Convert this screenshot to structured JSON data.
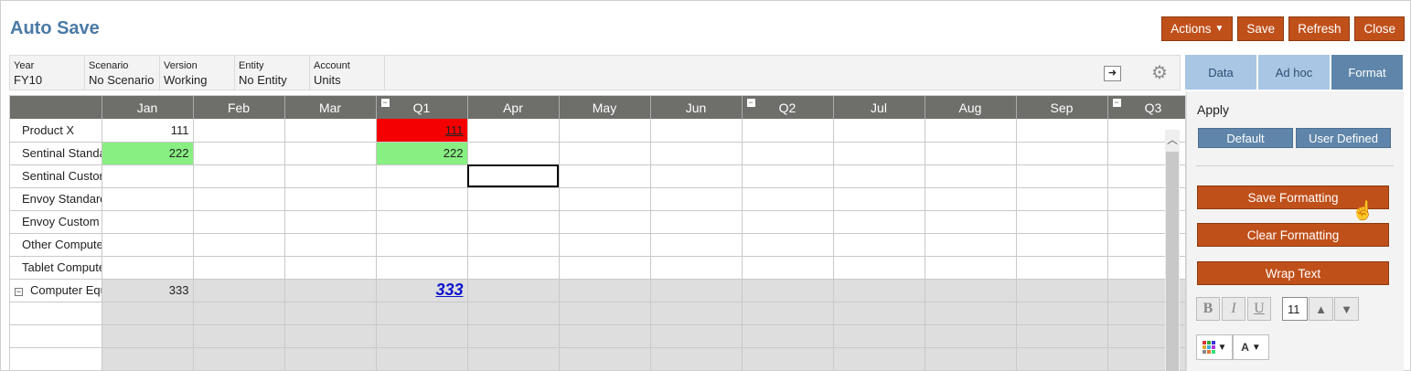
{
  "app": {
    "title": "Auto Save"
  },
  "toolbar": {
    "actions_label": "Actions",
    "save_label": "Save",
    "refresh_label": "Refresh",
    "close_label": "Close"
  },
  "pov": [
    {
      "label": "Year",
      "value": "FY10"
    },
    {
      "label": "Scenario",
      "value": "No Scenario"
    },
    {
      "label": "Version",
      "value": "Working"
    },
    {
      "label": "Entity",
      "value": "No Entity"
    },
    {
      "label": "Account",
      "value": "Units"
    }
  ],
  "panel_tabs": [
    "Data",
    "Ad hoc",
    "Format"
  ],
  "grid": {
    "columns": [
      "Jan",
      "Feb",
      "Mar",
      "Q1",
      "Apr",
      "May",
      "Jun",
      "Q2",
      "Jul",
      "Aug",
      "Sep",
      "Q3"
    ],
    "rows": [
      {
        "label": "Product X",
        "jan": "111",
        "q1": "111"
      },
      {
        "label": "Sentinal Standard",
        "jan": "222",
        "q1": "222"
      },
      {
        "label": "Sentinal Custom",
        "jan": "",
        "q1": ""
      },
      {
        "label": "Envoy Standard",
        "jan": "",
        "q1": ""
      },
      {
        "label": "Envoy Custom",
        "jan": "",
        "q1": ""
      },
      {
        "label": "Other Computers",
        "jan": "",
        "q1": ""
      },
      {
        "label": "Tablet Computers",
        "jan": "",
        "q1": ""
      },
      {
        "label": "Computer Equipment",
        "jan": "333",
        "q1": "333"
      }
    ]
  },
  "format_panel": {
    "apply_label": "Apply",
    "default_label": "Default",
    "user_defined_label": "User Defined",
    "save_formatting_label": "Save Formatting",
    "clear_formatting_label": "Clear Formatting",
    "wrap_text_label": "Wrap Text",
    "bold_label": "B",
    "italic_label": "I",
    "underline_label": "U",
    "font_size": "11"
  },
  "colors": {
    "accent": "#c0501a",
    "negative": "#f40000",
    "positive": "#88ef82"
  }
}
